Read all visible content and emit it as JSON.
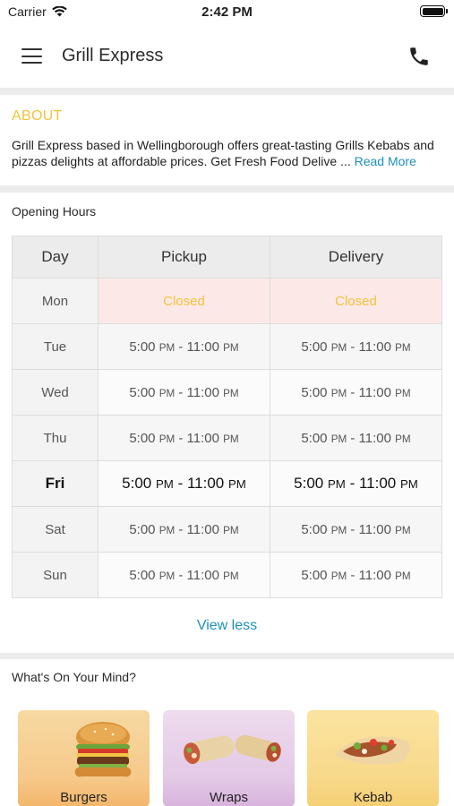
{
  "status_bar": {
    "carrier": "Carrier",
    "time": "2:42 PM"
  },
  "nav": {
    "title": "Grill Express"
  },
  "about": {
    "title": "ABOUT",
    "text": "Grill Express based in Wellingborough offers great-tasting Grills Kebabs and pizzas delights at affordable prices. Get Fresh Food Delive ...",
    "read_more": "Read More"
  },
  "hours": {
    "title": "Opening Hours",
    "headers": {
      "day": "Day",
      "pickup": "Pickup",
      "delivery": "Delivery"
    },
    "rows": [
      {
        "day": "Mon",
        "pickup": "Closed",
        "delivery": "Closed"
      },
      {
        "day": "Tue",
        "pickup": "5:00 PM - 11:00 PM",
        "delivery": "5:00 PM - 11:00 PM"
      },
      {
        "day": "Wed",
        "pickup": "5:00 PM - 11:00 PM",
        "delivery": "5:00 PM - 11:00 PM"
      },
      {
        "day": "Thu",
        "pickup": "5:00 PM - 11:00 PM",
        "delivery": "5:00 PM - 11:00 PM"
      },
      {
        "day": "Fri",
        "pickup": "5:00 PM - 11:00 PM",
        "delivery": "5:00 PM - 11:00 PM"
      },
      {
        "day": "Sat",
        "pickup": "5:00 PM - 11:00 PM",
        "delivery": "5:00 PM - 11:00 PM"
      },
      {
        "day": "Sun",
        "pickup": "5:00 PM - 11:00 PM",
        "delivery": "5:00 PM - 11:00 PM"
      }
    ],
    "view_less": "View less"
  },
  "categories": {
    "title": "What's On Your Mind?",
    "items": [
      {
        "label": "Burgers"
      },
      {
        "label": "Wraps"
      },
      {
        "label": "Kebab"
      }
    ]
  },
  "colors": {
    "accent_yellow": "#f2c43a",
    "link_blue": "#1e8fbf",
    "closed_bg": "#fde8e8"
  }
}
